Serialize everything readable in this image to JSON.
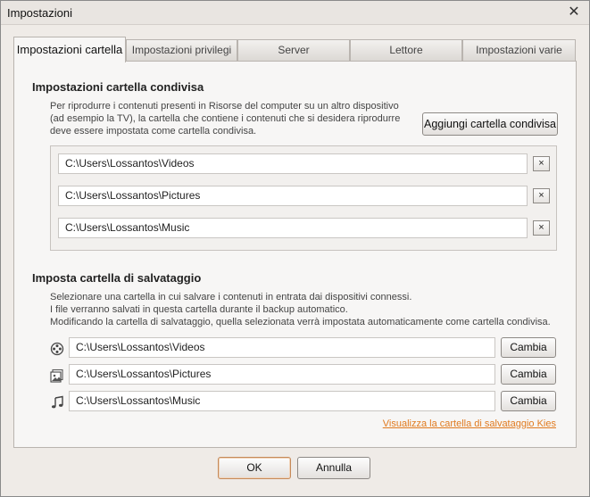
{
  "window": {
    "title": "Impostazioni"
  },
  "tabs": [
    {
      "label": "Impostazioni cartella",
      "active": true
    },
    {
      "label": "Impostazioni privilegi",
      "active": false
    },
    {
      "label": "Server",
      "active": false
    },
    {
      "label": "Lettore",
      "active": false
    },
    {
      "label": "Impostazioni varie",
      "active": false
    }
  ],
  "shared": {
    "title": "Impostazioni cartella condivisa",
    "desc_lines": [
      "Per riprodurre i contenuti presenti in Risorse del computer su un altro dispositivo",
      "(ad esempio la TV), la cartella che contiene i contenuti che si desidera riprodurre",
      "deve essere impostata come cartella condivisa."
    ],
    "add_button": "Aggiungi cartella condivisa",
    "folders": [
      {
        "path": "C:\\Users\\Lossantos\\Videos",
        "remove": "×"
      },
      {
        "path": "C:\\Users\\Lossantos\\Pictures",
        "remove": "×"
      },
      {
        "path": "C:\\Users\\Lossantos\\Music",
        "remove": "×"
      }
    ]
  },
  "backup": {
    "title": "Imposta cartella di salvataggio",
    "desc_lines": [
      "Selezionare una cartella in cui salvare i contenuti in entrata dai dispositivi connessi.",
      "I file verranno salvati in questa cartella durante il backup automatico.",
      "Modificando la cartella di salvataggio, quella selezionata verrà impostata automaticamente come cartella condivisa."
    ],
    "rows": [
      {
        "icon": "film-reel-icon",
        "path": "C:\\Users\\Lossantos\\Videos",
        "button": "Cambia"
      },
      {
        "icon": "picture-icon",
        "path": "C:\\Users\\Lossantos\\Pictures",
        "button": "Cambia"
      },
      {
        "icon": "music-note-icon",
        "path": "C:\\Users\\Lossantos\\Music",
        "button": "Cambia"
      }
    ],
    "link": "Visualizza la cartella di salvataggio Kies"
  },
  "footer": {
    "ok": "OK",
    "cancel": "Annulla"
  },
  "colors": {
    "accent_link": "#e07a1f",
    "ok_border": "#c58a5a"
  }
}
